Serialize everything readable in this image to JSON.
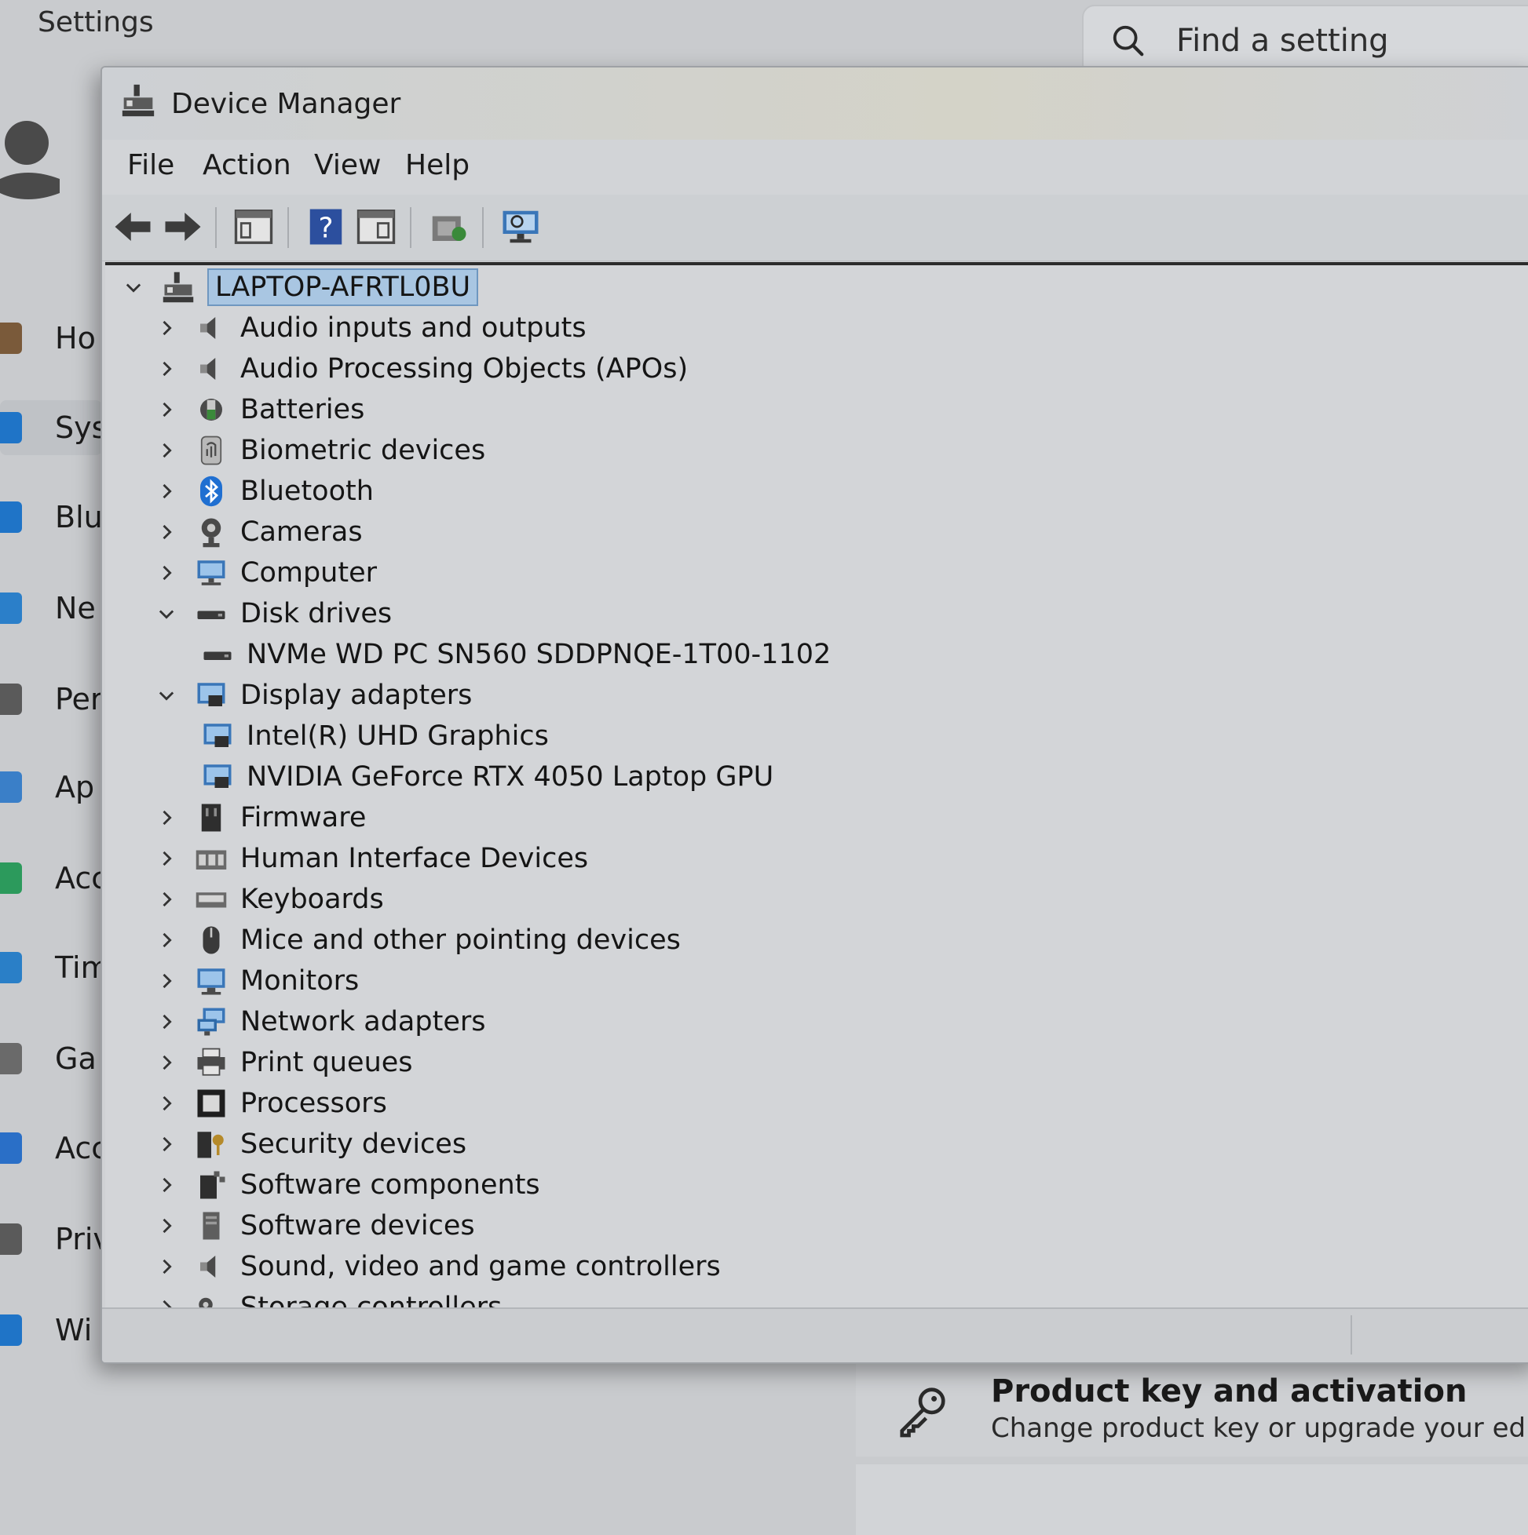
{
  "settings": {
    "title": "Settings",
    "search_placeholder": "Find a setting",
    "nav": [
      {
        "label": "Ho",
        "icon": "home-icon",
        "color": "#7a5a3a"
      },
      {
        "label": "Sys",
        "icon": "system-icon",
        "color": "#1f74c7"
      },
      {
        "label": "Blu",
        "icon": "bluetooth-icon",
        "color": "#1f74c7"
      },
      {
        "label": "Ne",
        "icon": "network-icon",
        "color": "#2b7fc9"
      },
      {
        "label": "Per",
        "icon": "personalization-icon",
        "color": "#5a5a5a"
      },
      {
        "label": "Ap",
        "icon": "apps-icon",
        "color": "#3a7fc8"
      },
      {
        "label": "Acc",
        "icon": "accounts-icon",
        "color": "#2c9a5c"
      },
      {
        "label": "Tim",
        "icon": "time-language-icon",
        "color": "#2a7fc7"
      },
      {
        "label": "Ga",
        "icon": "gaming-icon",
        "color": "#6a6a6a"
      },
      {
        "label": "Acc",
        "icon": "accessibility-icon",
        "color": "#2a6fc7"
      },
      {
        "label": "Priv",
        "icon": "privacy-icon",
        "color": "#5a5a5a"
      },
      {
        "label": "Wi",
        "icon": "windows-update-icon",
        "color": "#1f74c7"
      }
    ],
    "product_key": {
      "title": "Product key and activation",
      "subtitle": "Change product key or upgrade your edition"
    }
  },
  "device_manager": {
    "title": "Device Manager",
    "menu": [
      "File",
      "Action",
      "View",
      "Help"
    ],
    "toolbar": [
      "back-arrow-icon",
      "forward-arrow-icon",
      "show-hide-console-tree-icon",
      "help-icon",
      "properties-pane-icon",
      "update-driver-icon",
      "scan-hardware-icon"
    ],
    "root": "LAPTOP-AFRTL0BU",
    "tree": [
      {
        "label": "Audio inputs and outputs",
        "icon": "speaker-icon",
        "expanded": false,
        "level": 1
      },
      {
        "label": "Audio Processing Objects (APOs)",
        "icon": "speaker-icon",
        "expanded": false,
        "level": 1
      },
      {
        "label": "Batteries",
        "icon": "battery-icon",
        "expanded": false,
        "level": 1
      },
      {
        "label": "Biometric devices",
        "icon": "fingerprint-icon",
        "expanded": false,
        "level": 1
      },
      {
        "label": "Bluetooth",
        "icon": "bluetooth-icon",
        "expanded": false,
        "level": 1
      },
      {
        "label": "Cameras",
        "icon": "camera-icon",
        "expanded": false,
        "level": 1
      },
      {
        "label": "Computer",
        "icon": "computer-icon",
        "expanded": false,
        "level": 1
      },
      {
        "label": "Disk drives",
        "icon": "disk-drive-icon",
        "expanded": true,
        "level": 1
      },
      {
        "label": "NVMe WD PC SN560 SDDPNQE-1T00-1102",
        "icon": "disk-drive-icon",
        "level": 2
      },
      {
        "label": "Display adapters",
        "icon": "display-adapter-icon",
        "expanded": true,
        "level": 1
      },
      {
        "label": "Intel(R) UHD Graphics",
        "icon": "display-adapter-icon",
        "level": 2
      },
      {
        "label": "NVIDIA GeForce RTX 4050 Laptop GPU",
        "icon": "display-adapter-icon",
        "level": 2
      },
      {
        "label": "Firmware",
        "icon": "firmware-icon",
        "expanded": false,
        "level": 1
      },
      {
        "label": "Human Interface Devices",
        "icon": "hid-icon",
        "expanded": false,
        "level": 1
      },
      {
        "label": "Keyboards",
        "icon": "keyboard-icon",
        "expanded": false,
        "level": 1
      },
      {
        "label": "Mice and other pointing devices",
        "icon": "mouse-icon",
        "expanded": false,
        "level": 1
      },
      {
        "label": "Monitors",
        "icon": "monitor-icon",
        "expanded": false,
        "level": 1
      },
      {
        "label": "Network adapters",
        "icon": "network-adapter-icon",
        "expanded": false,
        "level": 1
      },
      {
        "label": "Print queues",
        "icon": "printer-icon",
        "expanded": false,
        "level": 1
      },
      {
        "label": "Processors",
        "icon": "processor-icon",
        "expanded": false,
        "level": 1
      },
      {
        "label": "Security devices",
        "icon": "security-device-icon",
        "expanded": false,
        "level": 1
      },
      {
        "label": "Software components",
        "icon": "software-component-icon",
        "expanded": false,
        "level": 1
      },
      {
        "label": "Software devices",
        "icon": "software-device-icon",
        "expanded": false,
        "level": 1
      },
      {
        "label": "Sound, video and game controllers",
        "icon": "speaker-icon",
        "expanded": false,
        "level": 1
      },
      {
        "label": "Storage controllers",
        "icon": "storage-controller-icon",
        "expanded": false,
        "level": 1
      }
    ]
  }
}
